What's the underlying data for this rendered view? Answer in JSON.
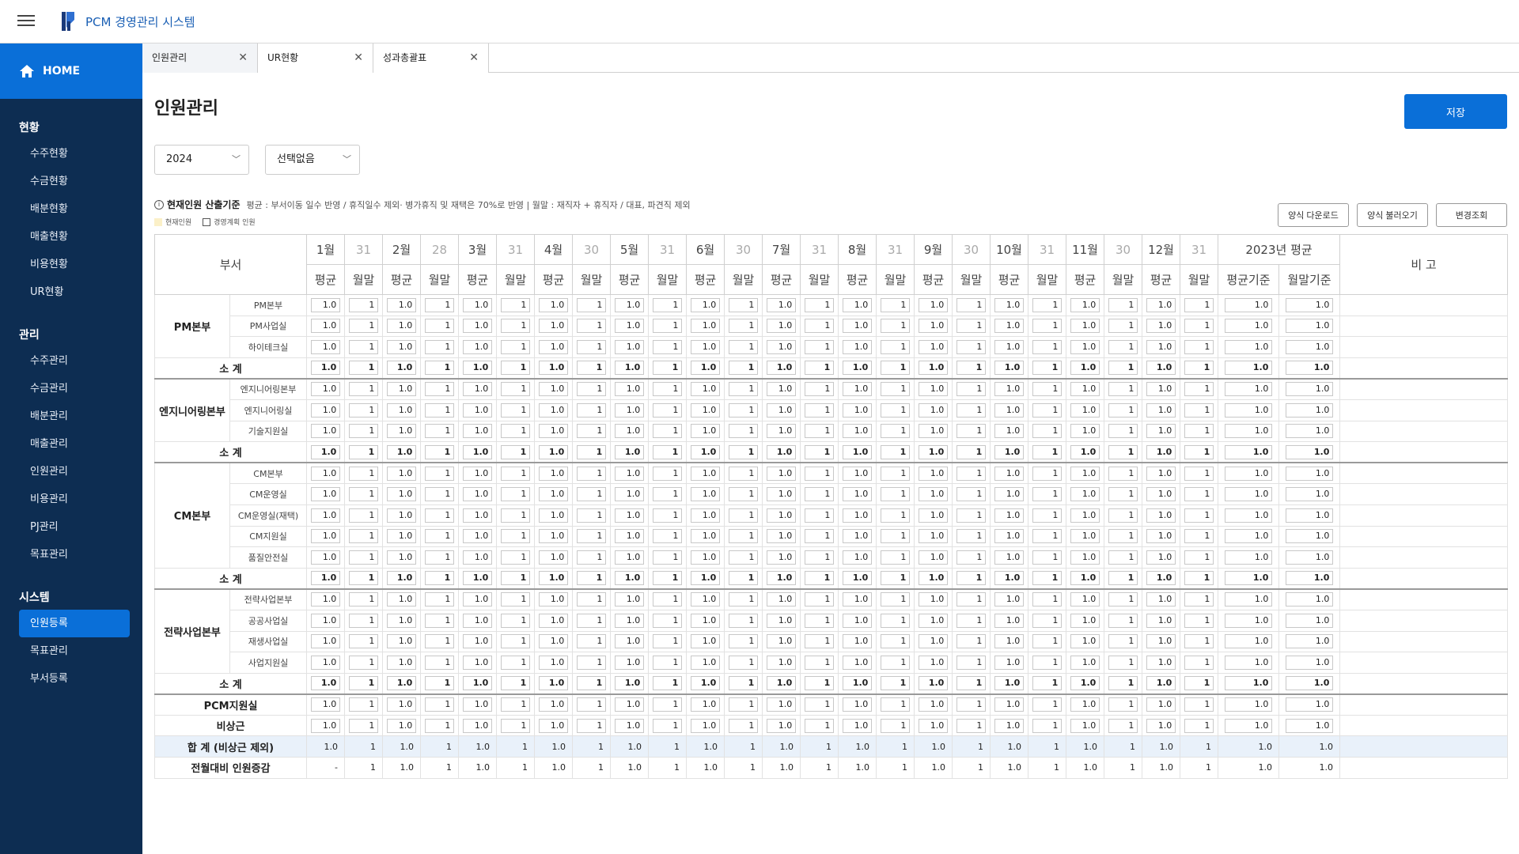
{
  "app": {
    "title": "PCM 경영관리 시스템"
  },
  "sidebar": {
    "home": "HOME",
    "sections": [
      {
        "title": "현황",
        "items": [
          "수주현황",
          "수금현황",
          "배분현황",
          "매출현황",
          "비용현황",
          "UR현황"
        ]
      },
      {
        "title": "관리",
        "items": [
          "수주관리",
          "수금관리",
          "배분관리",
          "매출관리",
          "인원관리",
          "비용관리",
          "PJ관리",
          "목표관리"
        ]
      },
      {
        "title": "시스템",
        "items": [
          "인원등록",
          "목표관리",
          "부서등록"
        ],
        "active": 0
      }
    ]
  },
  "tabs": [
    {
      "label": "인원관리"
    },
    {
      "label": "UR현황"
    },
    {
      "label": "성과총괄표"
    }
  ],
  "page": {
    "title": "인원관리",
    "save": "저장"
  },
  "filters": {
    "year": "2024",
    "option": "선택없음"
  },
  "info": {
    "heading": "현재인원 산출기준",
    "text": "평균 : 부서이동 일수 반영 / 휴직일수 제외· 병가휴직 및 재택은 70%로 반영  |  월말 : 재직자 + 휴직자 / 대표, 파견직 제외",
    "legend_current": "현재인원",
    "legend_plan": "경영계획 인원"
  },
  "colors": {
    "accent": "#0a6fd8",
    "sidebar": "#0d2d52",
    "current_legend": "#fbf0c8",
    "total_row": "#e9f1fa"
  },
  "buttons": {
    "download": "양식 다운로드",
    "upload": "양식 불러오기",
    "history": "변경조회"
  },
  "table": {
    "dept_header": "부서",
    "note_header": "비 고",
    "months": [
      {
        "m": "1월",
        "d": "31"
      },
      {
        "m": "2월",
        "d": "28"
      },
      {
        "m": "3월",
        "d": "31"
      },
      {
        "m": "4월",
        "d": "30"
      },
      {
        "m": "5월",
        "d": "31"
      },
      {
        "m": "6월",
        "d": "30"
      },
      {
        "m": "7월",
        "d": "31"
      },
      {
        "m": "8월",
        "d": "31"
      },
      {
        "m": "9월",
        "d": "30"
      },
      {
        "m": "10월",
        "d": "31"
      },
      {
        "m": "11월",
        "d": "30"
      },
      {
        "m": "12월",
        "d": "31"
      }
    ],
    "avg_label": "평균",
    "end_label": "월말",
    "prev_year": "2023년 평균",
    "prev_avg": "평균기준",
    "prev_end": "월말기준",
    "groups": [
      {
        "name": "PM본부",
        "teams": [
          "PM본부",
          "PM사업실",
          "하이테크실"
        ]
      },
      {
        "name": "엔지니어링본부",
        "teams": [
          "엔지니어링본부",
          "엔지니어링실",
          "기술지원실"
        ]
      },
      {
        "name": "CM본부",
        "teams": [
          "CM본부",
          "CM운영실",
          "CM운영실(재택)",
          "CM지원실",
          "품질안전실"
        ]
      },
      {
        "name": "전략사업본부",
        "teams": [
          "전략사업본부",
          "공공사업실",
          "재생사업실",
          "사업지원실"
        ]
      }
    ],
    "subtotal_label": "소 계",
    "extra_rows": [
      "PCM지원실",
      "비상근"
    ],
    "total_label": "합 계 (비상근 제외)",
    "diff_label": "전월대비 인원증감",
    "avg_value": "1.0",
    "end_value": "1",
    "diff_first": "-"
  }
}
